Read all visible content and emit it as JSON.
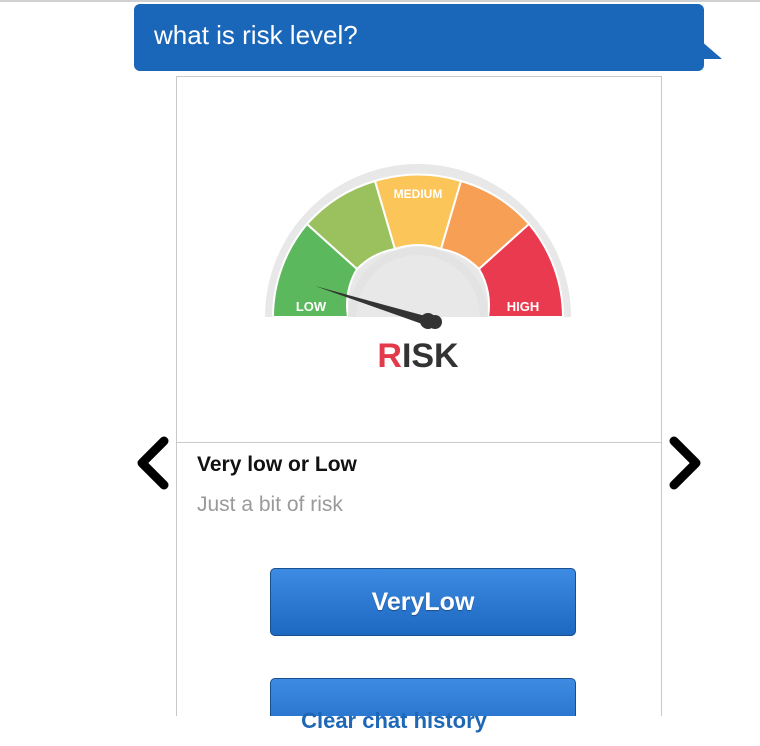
{
  "chat": {
    "user_message": "what is risk level?",
    "colors": {
      "accent": "#1a66b8",
      "button_top": "#3d8be2",
      "button_bottom": "#1d68c1",
      "link": "#1e67b7"
    }
  },
  "card": {
    "image": {
      "gauge_labels": {
        "low": "LOW",
        "medium": "MEDIUM",
        "high": "HIGH"
      },
      "caption_first": "R",
      "caption_rest": "ISK",
      "segment_colors": [
        "#5cb85c",
        "#9bc15f",
        "#fbc55a",
        "#f79f55",
        "#ea3a4f"
      ]
    },
    "title": "Very low or Low",
    "subtitle": "Just a bit of risk",
    "buttons": [
      {
        "label": "VeryLow"
      },
      {
        "label": ""
      }
    ]
  },
  "carousel": {
    "prev_icon": "chevron-left-icon",
    "next_icon": "chevron-right-icon"
  },
  "footer": {
    "clear_label": "Clear chat history"
  }
}
